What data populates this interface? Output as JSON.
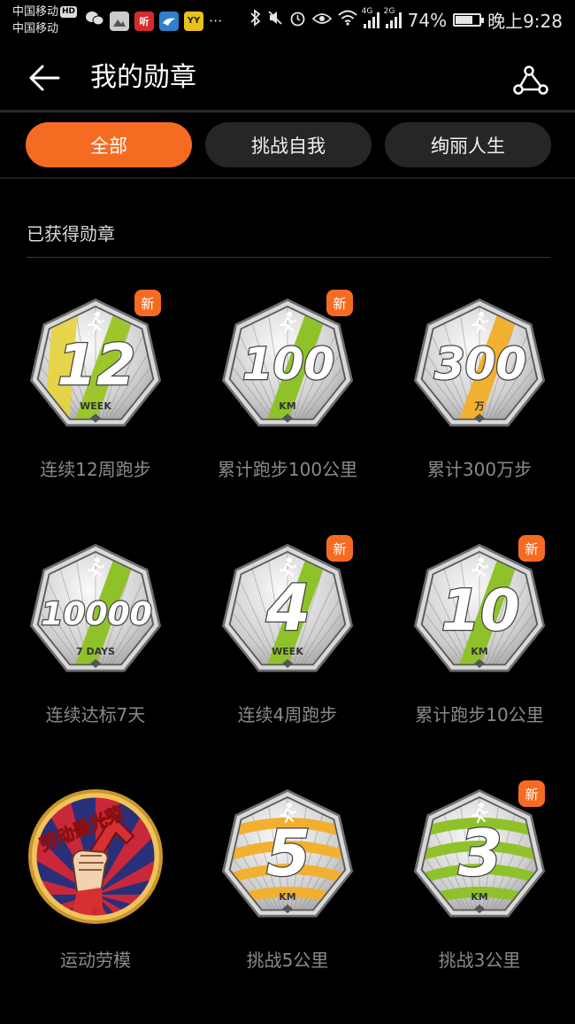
{
  "status_bar": {
    "carrier1": "中国移动",
    "carrier1_badge": "HD",
    "carrier2": "中国移动",
    "app_icons": [
      {
        "icon": "wechat-icon",
        "text": ""
      },
      {
        "icon": "gallery-icon",
        "text": ""
      },
      {
        "icon": "ting-icon",
        "text": "听"
      },
      {
        "icon": "bird-icon",
        "text": ""
      },
      {
        "icon": "yy-icon",
        "text": "YY"
      }
    ],
    "more": "···",
    "net1": "4G",
    "net2": "2G",
    "battery_text": "74%",
    "battery_level": 0.74,
    "time": "晚上9:28"
  },
  "header": {
    "title": "我的勋章",
    "back_icon": "arrow-left-icon",
    "share_icon": "share-icon"
  },
  "tabs": [
    {
      "label": "全部",
      "active": true
    },
    {
      "label": "挑战自我",
      "active": false
    },
    {
      "label": "绚丽人生",
      "active": false
    }
  ],
  "section": {
    "title": "已获得勋章"
  },
  "new_badge_text": "新",
  "medals": [
    {
      "label": "连续12周跑步",
      "number": "12",
      "unit": "WEEK",
      "stripe": "#9cc62c",
      "stripe2": "#e7d43a",
      "is_new": true
    },
    {
      "label": "累计跑步100公里",
      "number": "100",
      "unit": "KM",
      "stripe": "#8fc22a",
      "stripe2": "",
      "is_new": true
    },
    {
      "label": "累计300万步",
      "number": "300",
      "unit": "万",
      "stripe": "#f2b030",
      "stripe2": "",
      "is_new": false
    },
    {
      "label": "连续达标7天",
      "number": "10000",
      "unit": "7 DAYS",
      "stripe": "#8fc22a",
      "stripe2": "",
      "is_new": false
    },
    {
      "label": "连续4周跑步",
      "number": "4",
      "unit": "WEEK",
      "stripe": "#8fc22a",
      "stripe2": "",
      "is_new": true
    },
    {
      "label": "累计跑步10公里",
      "number": "10",
      "unit": "KM",
      "stripe": "#8fc22a",
      "stripe2": "",
      "is_new": true
    },
    {
      "label": "运动劳模",
      "number": "",
      "unit": "",
      "special": "laborer",
      "banner": "劳动最光荣",
      "is_new": false
    },
    {
      "label": "挑战5公里",
      "number": "5",
      "unit": "KM",
      "stripe": "#f2b030",
      "stripe2": "waves",
      "is_new": false
    },
    {
      "label": "挑战3公里",
      "number": "3",
      "unit": "KM",
      "stripe": "#8fc22a",
      "stripe2": "waves",
      "is_new": true
    }
  ]
}
